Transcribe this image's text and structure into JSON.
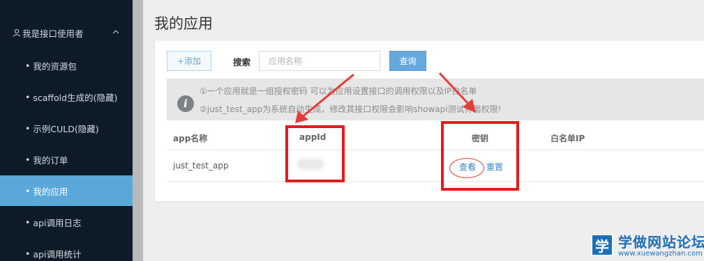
{
  "sidebar": {
    "group_label": "我是接口使用者",
    "items": [
      {
        "label": "我的资源包"
      },
      {
        "label": "scaffold生成的(隐藏)"
      },
      {
        "label": "示例CULD(隐藏)"
      },
      {
        "label": "我的订单"
      },
      {
        "label": "我的应用"
      },
      {
        "label": "api调用日志"
      },
      {
        "label": "api调用统计"
      }
    ],
    "bullet": "•",
    "active_index": 4
  },
  "page": {
    "title": "我的应用"
  },
  "toolbar": {
    "add_label": "+添加",
    "search_label": "搜索",
    "search_placeholder": "应用名称",
    "query_label": "查询"
  },
  "notice": {
    "line1": "①一个应用就是一组授权密码 可以为应用设置接口的调用权限以及IP白名单",
    "line2": "②just_test_app为系统自动生成，修改其接口权限会影响showapi测试界面权限!"
  },
  "table": {
    "headers": [
      "app名称",
      "appId",
      "密钥",
      "白名单IP"
    ],
    "rows": [
      {
        "app_name": "just_test_app",
        "view_label": "查看",
        "reset_label": "重置"
      }
    ]
  },
  "watermark": {
    "logo_char": "学",
    "name": "学做网站论坛",
    "url": "www.xuewangzhan.com"
  },
  "colors": {
    "sidebar_bg": "#0d1b29",
    "active_item": "#5aa8da",
    "primary_button": "#68a9dd",
    "annotation_red": "#e41b1b",
    "link": "#3c84c5"
  }
}
